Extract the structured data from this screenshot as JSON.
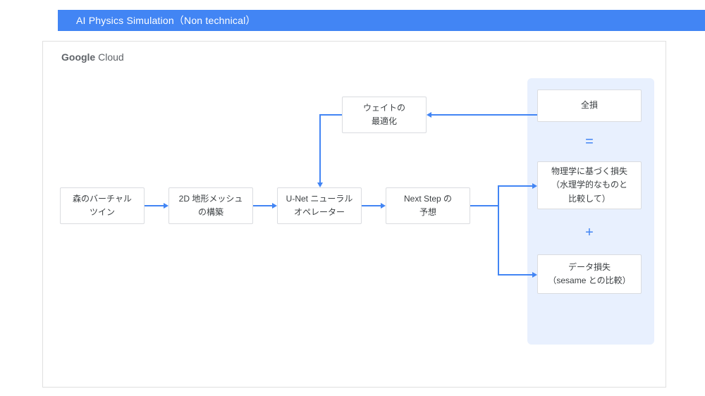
{
  "title": "AI Physics Simulation（Non technical）",
  "brand": {
    "part1": "Google",
    "part2": " Cloud"
  },
  "nodes": {
    "virtual_twin": "森のバーチャル\nツイン",
    "mesh": "2D 地形メッシュ\nの構築",
    "unet": "U-Net ニューラル\nオペレーター",
    "next_step": "Next Step の\n予想",
    "weight_opt": "ウェイトの\n最適化",
    "total_loss": "全損",
    "physics_loss": "物理学に基づく損失\n（水理学的なものと\n比較して）",
    "data_loss": "データ損失\n（sesame との比較）"
  },
  "ops": {
    "equals": "=",
    "plus": "+"
  }
}
